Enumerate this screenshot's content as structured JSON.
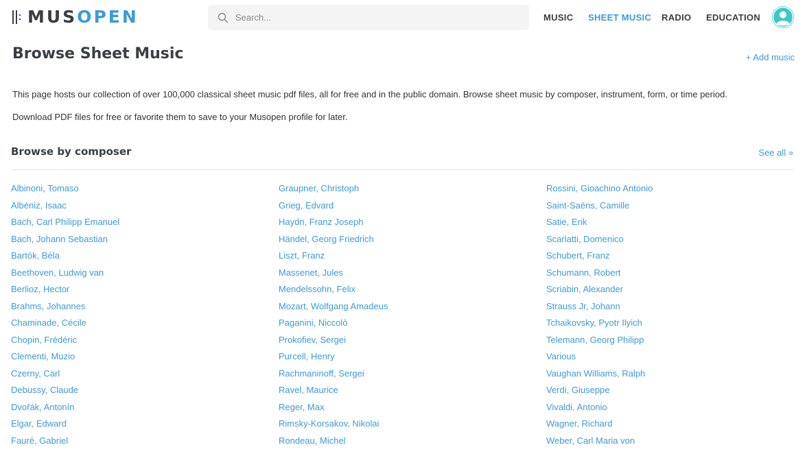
{
  "header": {
    "logo": {
      "part1": "MUS",
      "part2": "OPEN"
    },
    "search": {
      "placeholder": "Search..."
    },
    "nav": [
      {
        "label": "MUSIC",
        "active": false
      },
      {
        "label": "SHEET MUSIC",
        "active": true
      },
      {
        "label": "RADIO",
        "active": false
      },
      {
        "label": "EDUCATION",
        "active": false
      }
    ],
    "avatar_icon": "user-avatar-icon"
  },
  "page": {
    "title": "Browse Sheet Music",
    "add_music": "+ Add music",
    "intro_1": "This page hosts our collection of over 100,000 classical sheet music pdf files, all for free and in the public domain. Browse sheet music by composer, instrument, form, or time period.",
    "intro_2": "Download PDF files for free or favorite them to save to your Musopen profile for later."
  },
  "composers": {
    "heading": "Browse by composer",
    "see_all": "See all »",
    "columns": [
      [
        "Albinoni, Tomaso",
        "Albéniz, Isaac",
        "Bach, Carl Philipp Emanuel",
        "Bach, Johann Sebastian",
        "Bartók, Béla",
        "Beethoven, Ludwig van",
        "Berlioz, Hector",
        "Brahms, Johannes",
        "Chaminade, Cécile",
        "Chopin, Frédéric",
        "Clementi, Muzio",
        "Czerny, Carl",
        "Debussy, Claude",
        "Dvořák, Antonín",
        "Elgar, Edward",
        "Fauré, Gabriel"
      ],
      [
        "Graupner, Christoph",
        "Grieg, Edvard",
        "Haydn, Franz Joseph",
        "Händel, Georg Friedrich",
        "Liszt, Franz",
        "Massenet, Jules",
        "Mendelssohn, Felix",
        "Mozart, Wolfgang Amadeus",
        "Paganini, Niccolò",
        "Prokofiev, Sergei",
        "Purcell, Henry",
        "Rachmaninoff, Sergei",
        "Ravel, Maurice",
        "Reger, Max",
        "Rimsky-Korsakov, Nikolai",
        "Rondeau, Michel"
      ],
      [
        "Rossini, Gioachino Antonio",
        "Saint-Saëns, Camille",
        "Satie, Erik",
        "Scarlatti, Domenico",
        "Schubert, Franz",
        "Schumann, Robert",
        "Scriabin, Alexander",
        "Strauss Jr, Johann",
        "Tchaikovsky, Pyotr Ilyich",
        "Telemann, Georg Philipp",
        "Various",
        "Vaughan Williams, Ralph",
        "Verdi, Giuseppe",
        "Vivaldi, Antonio",
        "Wagner, Richard",
        "Weber, Carl Maria von"
      ]
    ]
  },
  "colors": {
    "accent": "#3b9bd6",
    "text_dark": "#3a3f44",
    "avatar": "#3ec7c7",
    "search_bg": "#f4f4f4"
  }
}
